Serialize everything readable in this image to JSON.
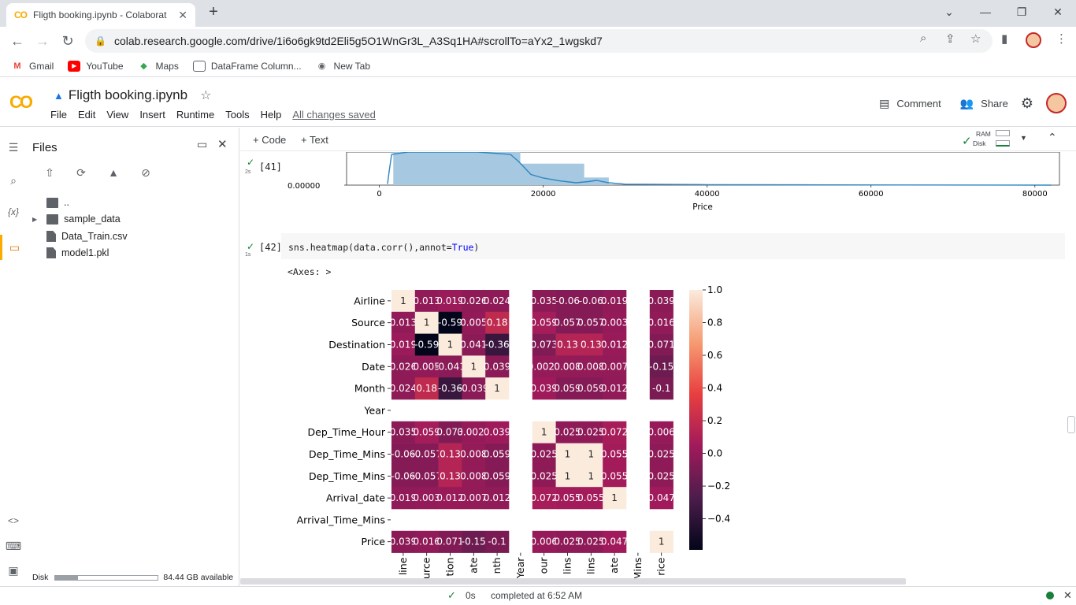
{
  "browser": {
    "tab_title": "Fligth booking.ipynb - Colaborat",
    "tab_close": "✕",
    "new_tab": "+",
    "url": "colab.research.google.com/drive/1i6o6gk9td2Eli5g5O1WnGr3L_A3Sq1HA#scrollTo=aYx2_1wgskd7",
    "bookmarks": [
      "Gmail",
      "YouTube",
      "Maps",
      "DataFrame Column...",
      "New Tab"
    ]
  },
  "colab": {
    "logo": "CO",
    "notebook_title": "Fligth booking.ipynb",
    "menu": [
      "File",
      "Edit",
      "View",
      "Insert",
      "Runtime",
      "Tools",
      "Help"
    ],
    "saved_status": "All changes saved",
    "comment_label": "Comment",
    "share_label": "Share",
    "add_code": "+ Code",
    "add_text": "+ Text",
    "ram_label": "RAM",
    "disk_label": "Disk"
  },
  "files_panel": {
    "title": "Files",
    "parent": "..",
    "items": [
      "sample_data",
      "Data_Train.csv",
      "model1.pkl"
    ],
    "disk_label": "Disk",
    "disk_available": "84.44 GB available",
    "disk_used_fraction": 0.22
  },
  "cells": {
    "cell41": {
      "num": "[41]",
      "time": "2s"
    },
    "cell42": {
      "num": "[42]",
      "time": "1s",
      "code_pre": "sns.heatmap(data.corr(),annot=",
      "code_kw": "True",
      "code_post": ")"
    },
    "axes_output": "<Axes: >"
  },
  "status": {
    "time": "0s",
    "completed": "completed at 6:52 AM"
  },
  "colors": {
    "accent": "#f9ab00",
    "hist_bar": "#a6c8e0",
    "kde_line": "#2e86c1",
    "check": "#188038"
  },
  "chart_data": [
    {
      "type": "area",
      "xlabel": "Price",
      "x_ticks": [
        0,
        20000,
        40000,
        60000,
        80000
      ],
      "x_tick_labels": [
        "0",
        "20000",
        "40000",
        "60000",
        "80000"
      ],
      "y_tick_labels": [
        "0.00000"
      ],
      "xlim": [
        -4000,
        83000
      ],
      "bars": [
        {
          "x0": 1700,
          "x1": 17200,
          "h": 1.0
        },
        {
          "x0": 17200,
          "x1": 25000,
          "h": 0.62
        },
        {
          "x0": 25000,
          "x1": 28000,
          "h": 0.22
        }
      ],
      "kde": [
        [
          1000,
          0.05
        ],
        [
          1200,
          0.6
        ],
        [
          1500,
          1.3
        ],
        [
          3500,
          1.4
        ],
        [
          12000,
          1.4
        ],
        [
          16000,
          1.3
        ],
        [
          17000,
          1.0
        ],
        [
          18500,
          0.45
        ],
        [
          20000,
          0.3
        ],
        [
          22000,
          0.18
        ],
        [
          24000,
          0.1
        ],
        [
          25500,
          0.15
        ],
        [
          26500,
          0.2
        ],
        [
          28000,
          0.1
        ],
        [
          30000,
          0.04
        ],
        [
          40000,
          0.02
        ],
        [
          55000,
          0.01
        ],
        [
          82000,
          0.0
        ]
      ]
    },
    {
      "type": "heatmap",
      "labels": [
        "Airline",
        "Source",
        "Destination",
        "Date",
        "Month",
        "Year",
        "Dep_Time_Hour",
        "Dep_Time_Mins",
        "Dep_Time_Mins",
        "Arrival_date",
        "Arrival_Time_Mins",
        "Price"
      ],
      "x_tick_labels": [
        "line",
        "urce",
        "tion",
        "ate",
        "nth",
        "Year",
        "our",
        "lins",
        "lins",
        "ate",
        "Mins",
        "rice"
      ],
      "values": [
        [
          1,
          -0.013,
          0.019,
          -0.026,
          -0.024,
          null,
          -0.035,
          -0.06,
          -0.06,
          -0.019,
          null,
          -0.039
        ],
        [
          -0.013,
          1,
          -0.59,
          -0.005,
          0.18,
          null,
          0.059,
          -0.057,
          -0.057,
          -0.003,
          null,
          -0.016
        ],
        [
          0.019,
          -0.59,
          1,
          -0.041,
          -0.36,
          null,
          -0.073,
          0.13,
          0.13,
          0.012,
          null,
          -0.071
        ],
        [
          -0.026,
          -0.005,
          -0.041,
          1,
          -0.039,
          null,
          0.0023,
          -0.008,
          -0.008,
          -0.007,
          null,
          -0.15
        ],
        [
          -0.024,
          0.18,
          -0.36,
          -0.039,
          1,
          null,
          0.039,
          -0.059,
          -0.059,
          -0.012,
          null,
          -0.1
        ],
        [
          null,
          null,
          null,
          null,
          null,
          null,
          null,
          null,
          null,
          null,
          null,
          null
        ],
        [
          -0.035,
          0.059,
          -0.073,
          0.0023,
          0.039,
          null,
          1,
          -0.025,
          -0.025,
          0.072,
          null,
          0.006
        ],
        [
          -0.06,
          -0.057,
          0.13,
          -0.008,
          -0.059,
          null,
          -0.025,
          1,
          1,
          0.055,
          null,
          -0.025
        ],
        [
          -0.06,
          -0.057,
          0.13,
          -0.008,
          -0.059,
          null,
          -0.025,
          1,
          1,
          0.055,
          null,
          -0.025
        ],
        [
          -0.019,
          -0.003,
          0.012,
          -0.007,
          -0.012,
          null,
          0.072,
          0.055,
          0.055,
          1,
          null,
          0.047
        ],
        [
          null,
          null,
          null,
          null,
          null,
          null,
          null,
          null,
          null,
          null,
          null,
          null
        ],
        [
          -0.039,
          -0.016,
          -0.071,
          -0.15,
          -0.1,
          null,
          0.006,
          -0.025,
          -0.025,
          0.047,
          null,
          1
        ]
      ],
      "annotations": [
        [
          "1",
          "0.013",
          "0.019",
          "0.026",
          "0.024",
          "",
          "0.035",
          "-0.06",
          "-0.06",
          "0.019",
          "",
          "0.039"
        ],
        [
          "0.013",
          "1",
          "-0.59",
          "0.005",
          "0.18",
          "",
          "0.059",
          "0.057",
          "0.057",
          "0.003",
          "",
          "0.016"
        ],
        [
          "0.019",
          "-0.59",
          "1",
          "0.041",
          "-0.36",
          "",
          "0.073",
          "0.13",
          "0.13",
          "0.012",
          "",
          "0.071"
        ],
        [
          "0.026",
          "0.005",
          "-0.041",
          "1",
          "0.039",
          "",
          "0.0023",
          "0.008",
          "0.008",
          "0.007",
          "",
          "-0.15"
        ],
        [
          "0.024",
          "0.18",
          "-0.36",
          "-0.039",
          "1",
          "",
          "0.039",
          "0.059",
          "0.059",
          "0.012",
          "",
          "-0.1"
        ],
        [
          "",
          "",
          "",
          "",
          "",
          "",
          "",
          "",
          "",
          "",
          "",
          ""
        ],
        [
          "0.035",
          "0.059",
          "0.073",
          "0.0023",
          "0.039",
          "",
          "1",
          "0.025",
          "0.025",
          "0.072",
          "",
          "0.006"
        ],
        [
          "-0.06",
          "-0.057",
          "0.13",
          "0.008",
          "0.059",
          "",
          "0.025",
          "1",
          "1",
          "0.055",
          "",
          "0.025"
        ],
        [
          "-0.06",
          "-0.057",
          "0.13",
          "0.008",
          "0.059",
          "",
          "0.025",
          "1",
          "1",
          "0.055",
          "",
          "0.025"
        ],
        [
          "0.019",
          "0.003",
          "0.012",
          "0.007",
          "0.012",
          "",
          "0.072",
          "0.055",
          "0.055",
          "1",
          "",
          "0.047"
        ],
        [
          "",
          "",
          "",
          "",
          "",
          "",
          "",
          "",
          "",
          "",
          "",
          ""
        ],
        [
          "0.039",
          "0.016",
          "0.071",
          "-0.15",
          "-0.1",
          "",
          "0.006",
          "0.025",
          "0.025",
          "0.047",
          "",
          "1"
        ]
      ],
      "colorbar_ticks": [
        1.0,
        0.8,
        0.6,
        0.4,
        0.2,
        0.0,
        -0.2,
        -0.4
      ],
      "colorbar_tick_labels": [
        "1.0",
        "0.8",
        "0.6",
        "0.4",
        "0.2",
        "0.0",
        "−0.2",
        "−0.4"
      ],
      "vmin": -0.59,
      "vmax": 1.0
    }
  ]
}
